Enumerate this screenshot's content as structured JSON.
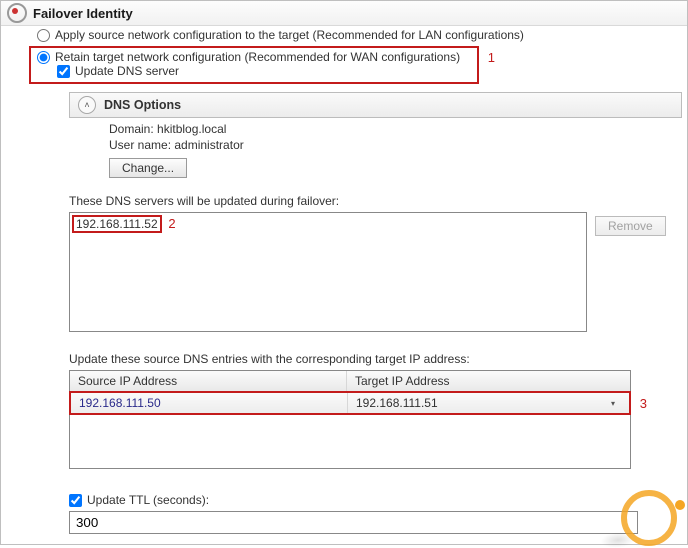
{
  "header": {
    "title": "Failover Identity"
  },
  "options": {
    "apply_source": {
      "label": "Apply source network configuration to the target (Recommended for LAN configurations)",
      "selected": false
    },
    "retain_target": {
      "label": "Retain target network configuration (Recommended for WAN configurations)",
      "selected": true
    },
    "update_dns": {
      "label": "Update DNS server",
      "checked": true
    }
  },
  "annotations": {
    "a1": "1",
    "a2": "2",
    "a3": "3"
  },
  "dns": {
    "section_title": "DNS Options",
    "domain_label": "Domain:",
    "domain_value": "hkitblog.local",
    "user_label": "User name:",
    "user_value": "administrator",
    "change_btn": "Change...",
    "servers_label": "These DNS servers will be updated during failover:",
    "server_ip": "192.168.111.52",
    "remove_btn": "Remove",
    "mapping_label": "Update these source DNS entries with the corresponding target IP address:",
    "col_source": "Source IP Address",
    "col_target": "Target IP Address",
    "row_source": "192.168.111.50",
    "row_target": "192.168.111.51",
    "ttl_label": "Update TTL (seconds):",
    "ttl_value": "300",
    "ttl_checked": true
  }
}
